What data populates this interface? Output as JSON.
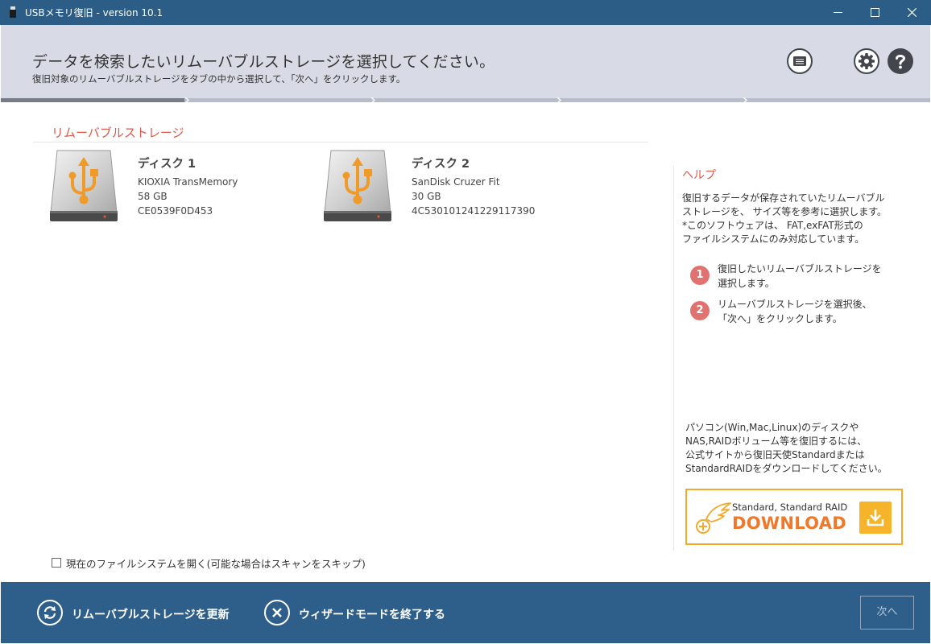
{
  "window": {
    "title": "USBメモリ復旧 - version 10.1"
  },
  "header": {
    "heading": "データを検索したいリムーバブルストレージを選択してください。",
    "subheading": "復旧対象のリムーバブルストレージをタブの中から選択して、「次へ」をクリックします。"
  },
  "progress": {
    "current_step": 1,
    "total_steps": 5
  },
  "storage": {
    "section_title": "リムーバブルストレージ",
    "disks": [
      {
        "name": "ディスク 1",
        "model": "KIOXIA TransMemory",
        "size": "58 GB",
        "serial": "CE0539F0D453"
      },
      {
        "name": "ディスク 2",
        "model": "SanDisk Cruzer Fit",
        "size": "30 GB",
        "serial": "4C530101241229117390"
      }
    ]
  },
  "help": {
    "title": "ヘルプ",
    "description": [
      "復旧するデータが保存されていたリムーバブル",
      "ストレージを、 サイズ等を参考に選択します。",
      "*このソフトウェアは、 FAT,exFAT形式の",
      "ファイルシステムにのみ対応しています。"
    ],
    "steps": [
      {
        "number": "1",
        "lines": [
          "復旧したいリムーバブルストレージを",
          "選択します。"
        ]
      },
      {
        "number": "2",
        "lines": [
          "リムーバブルストレージを選択後、",
          "「次へ」をクリックします。"
        ]
      }
    ],
    "promo": [
      "パソコン(Win,Mac,Linux)のディスクや",
      "NAS,RAIDボリューム等を復旧するには、",
      "公式サイトから復旧天使Standardまたは",
      "StandardRAIDをダウンロードしてください。"
    ],
    "download": {
      "subtitle": "Standard, Standard RAID",
      "label": "DOWNLOAD"
    }
  },
  "options": {
    "open_fs_label": "現在のファイルシステムを開く(可能な場合はスキャンをスキップ)",
    "open_fs_checked": false
  },
  "footer": {
    "refresh_label": "リムーバブルストレージを更新",
    "exit_label": "ウィザードモードを終了する",
    "next_label": "次へ"
  },
  "colors": {
    "titlebar": "#2c5d86",
    "header_bg": "#d8dbe6",
    "accent_red": "#e0574a",
    "step_badge": "#e07370",
    "usb_orange": "#f09a2a",
    "download_orange": "#f0782a",
    "footer_bg": "#2e5f8a"
  },
  "icons": {
    "app": "usb-stick-icon",
    "display": "display-icon",
    "settings": "gear-icon",
    "help": "question-icon",
    "disk": "usb-drive-icon",
    "refresh": "refresh-icon",
    "exit": "close-icon",
    "download": "download-icon",
    "logo": "angel-wing-logo"
  }
}
